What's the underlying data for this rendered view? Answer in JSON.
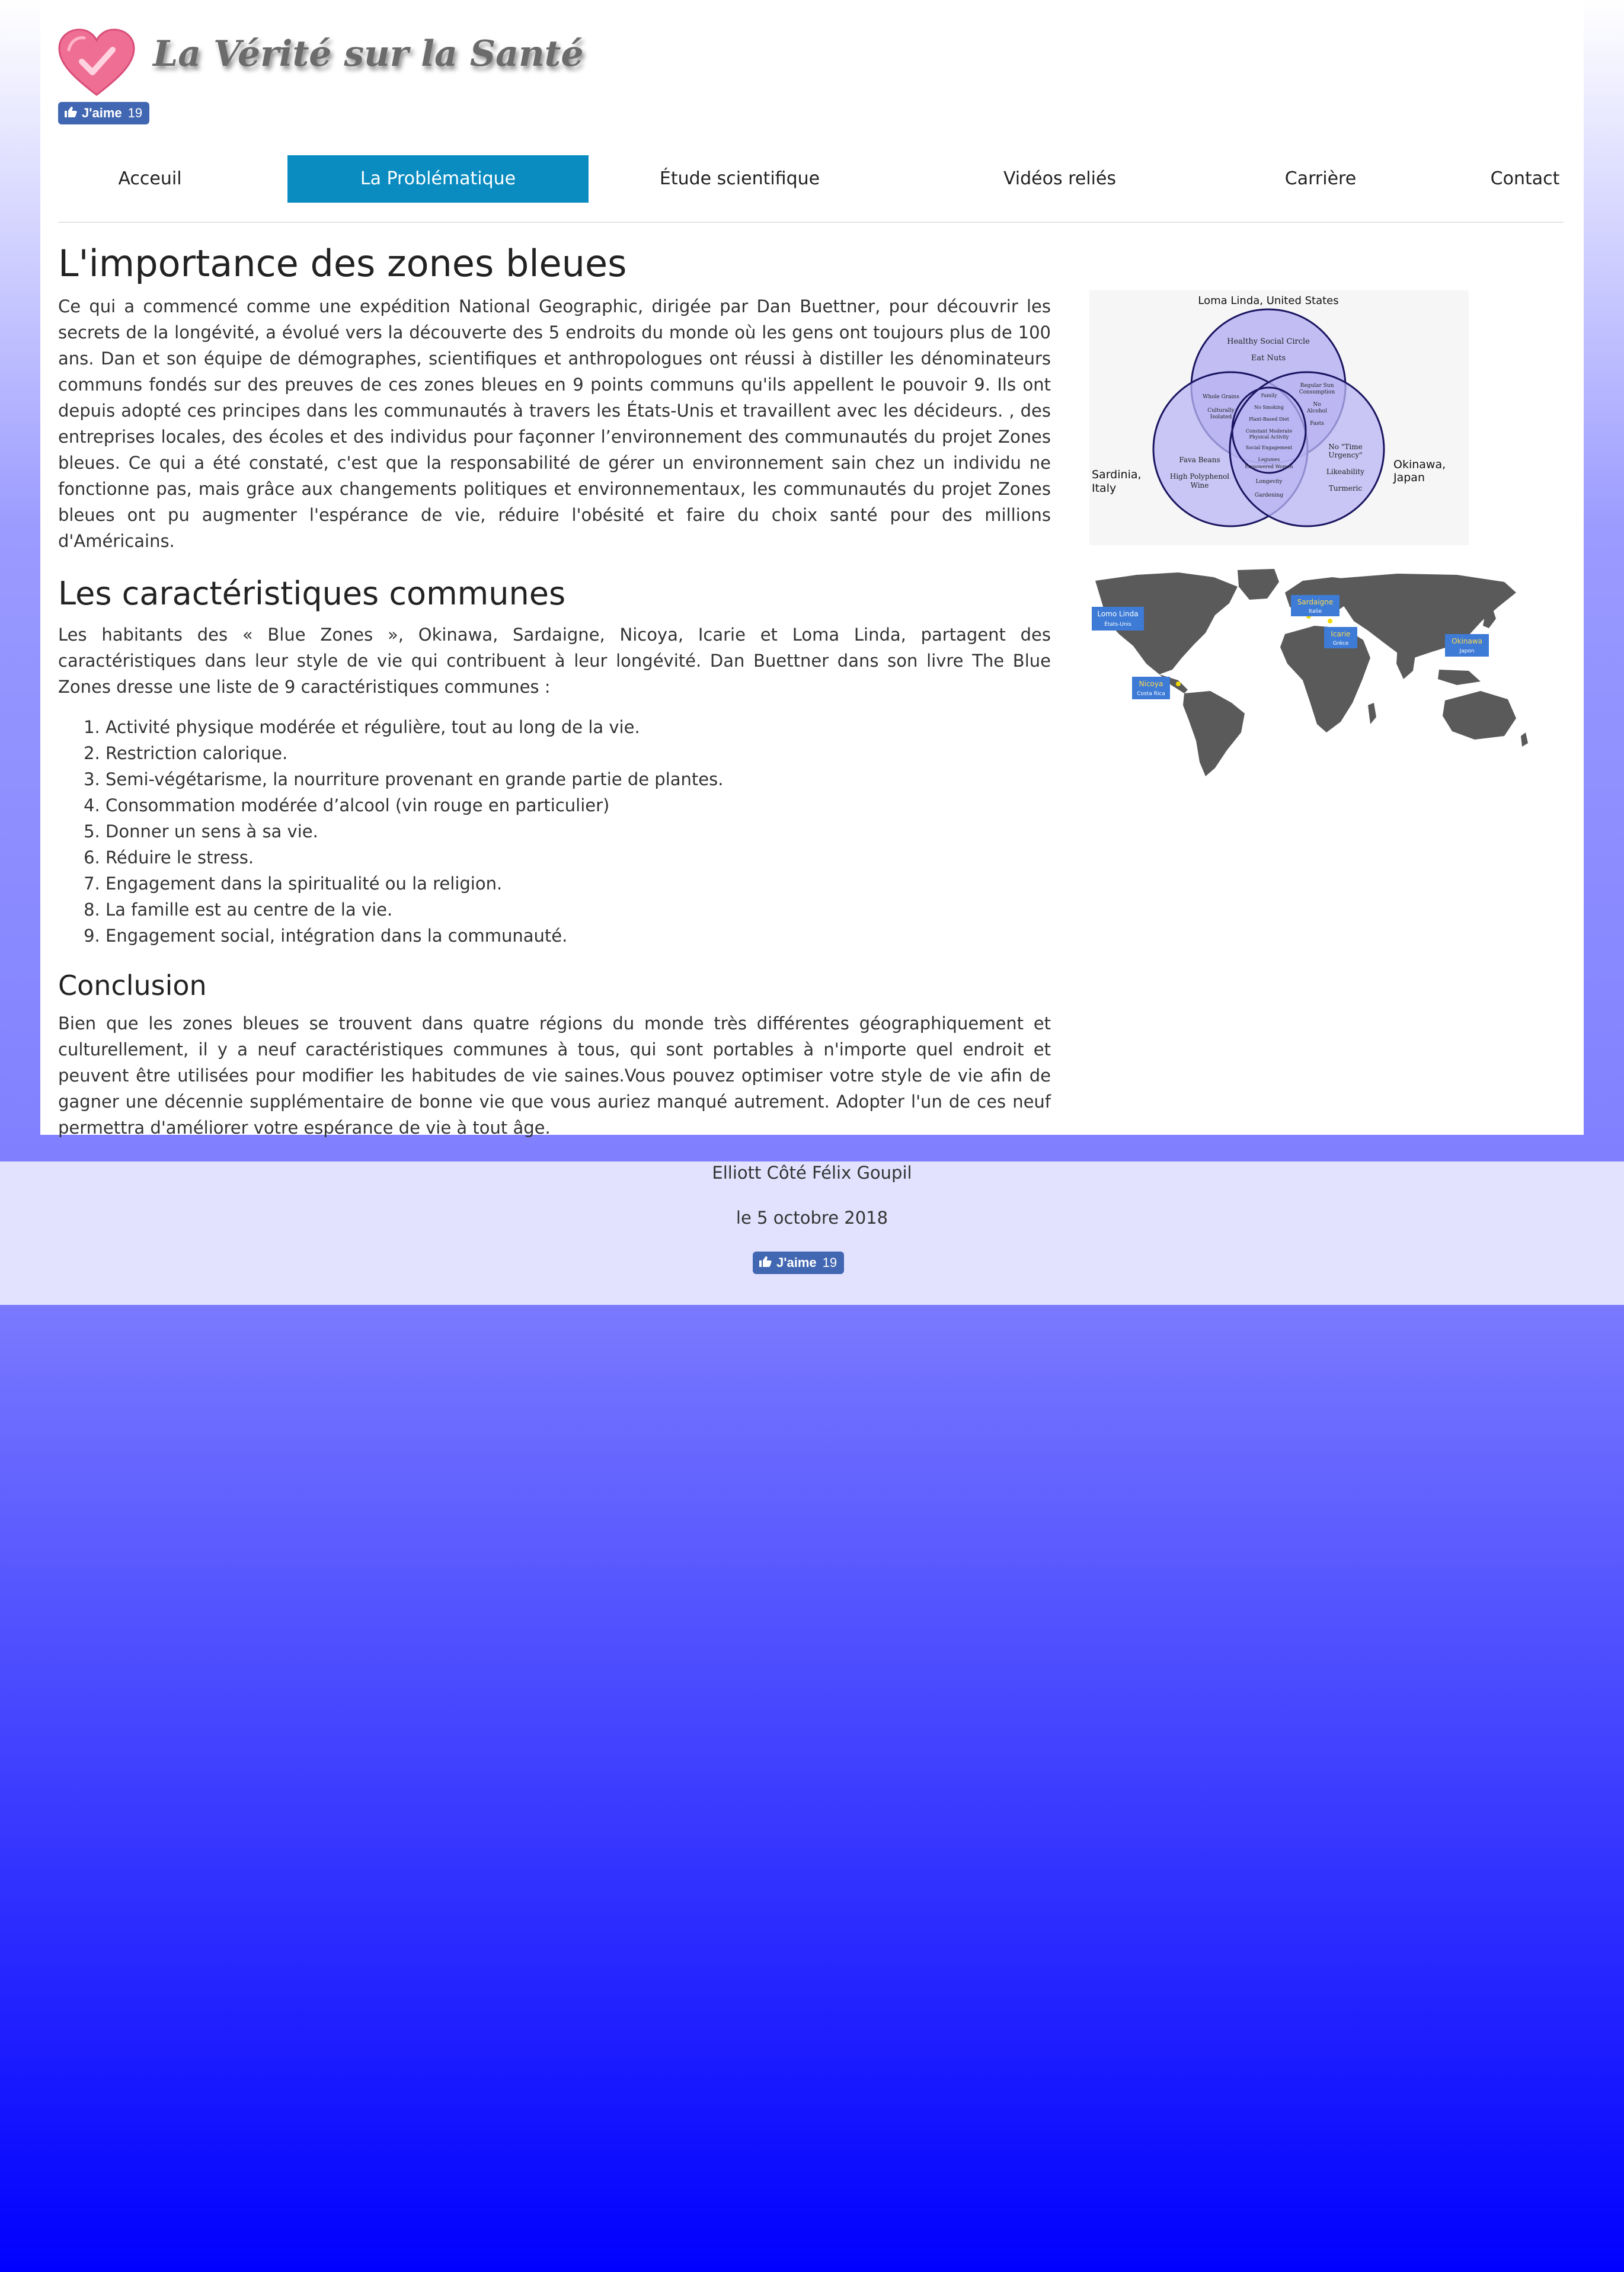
{
  "header": {
    "logo_text": "La Vérité sur la Santé",
    "like_button": {
      "label": "J'aime",
      "count": "19"
    }
  },
  "nav": {
    "items": [
      {
        "label": "Acceuil",
        "active": false
      },
      {
        "label": "La Problématique",
        "active": true
      },
      {
        "label": "Étude scientifique",
        "active": false
      },
      {
        "label": "Vidéos reliés",
        "active": false
      },
      {
        "label": "Carrière",
        "active": false
      },
      {
        "label": "Contact",
        "active": false
      }
    ],
    "active_color": "#0a8cc1"
  },
  "main": {
    "title": "L'importance des zones bleues",
    "intro": "Ce qui a commencé comme une expédition National Geographic, dirigée par Dan Buettner, pour découvrir les secrets de la longévité, a évolué vers la découverte des 5 endroits du monde où les gens ont toujours plus de 100 ans. Dan et son équipe de démographes, scientifiques et anthropologues ont réussi à distiller les dénominateurs communs fondés sur des preuves de ces zones bleues en 9 points communs qu'ils appellent le pouvoir 9. Ils ont depuis adopté ces principes dans les communautés à travers les États-Unis et travaillent avec les décideurs. , des entreprises locales, des écoles et des individus pour façonner l’environnement des communautés du projet Zones bleues. Ce qui a été constaté, c'est que la responsabilité de gérer un environnement sain chez un individu ne fonctionne pas, mais grâce aux changements politiques et environnementaux, les communautés du projet Zones bleues ont pu augmenter l'espérance de vie, réduire l'obésité et faire du choix santé pour des millions d'Américains.",
    "section2_title": "Les caractéristiques communes",
    "section2_text": "Les habitants des « Blue Zones », Okinawa, Sardaigne, Nicoya, Icarie et Loma Linda, partagent des caractéristiques dans leur style de vie qui contribuent à leur longévité. Dan Buettner dans son livre The Blue Zones dresse une liste de 9 caractéristiques communes :",
    "list": [
      "Activité physique modérée et régulière, tout au long de la vie.",
      "Restriction calorique.",
      "Semi-végétarisme, la nourriture provenant en grande partie de plantes.",
      "Consommation modérée d’alcool (vin rouge en particulier)",
      "Donner un sens à sa vie.",
      "Réduire le stress.",
      "Engagement dans la spiritualité ou la religion.",
      "La famille est au centre de la vie.",
      "Engagement social, intégration dans la communauté."
    ],
    "conclusion_title": "Conclusion",
    "conclusion_text": "Bien que les zones bleues se trouvent dans quatre régions du monde très différentes géographiquement et culturellement, il y a neuf caractéristiques communes à tous, qui sont portables à n'importe quel endroit et peuvent être utilisées pour modifier les habitudes de vie saines.Vous pouvez optimiser votre style de vie afin de gagner une décennie supplémentaire de bonne vie que vous auriez manqué autrement. Adopter l'un de ces neuf permettra d'améliorer votre espérance de vie à tout âge."
  },
  "venn": {
    "top_label": "Loma Linda, United States",
    "left_label_1": "Sardinia,",
    "left_label_2": "Italy",
    "right_label_1": "Okinawa,",
    "right_label_2": "Japan",
    "top_only": [
      "Healthy Social Circle",
      "Eat Nuts"
    ],
    "left_only": [
      "Fava Beans",
      "High Polyphenol",
      "Wine"
    ],
    "right_only": [
      "No \"Time",
      "Urgency\"",
      "Likeability",
      "Turmeric"
    ],
    "top_left": [
      "Whole Grains",
      "Culturally",
      "Isolated"
    ],
    "top_right": [
      "Regular Sun",
      "Consumption",
      "No",
      "Alcohol",
      "Fasts"
    ],
    "center": [
      "Family",
      "No Smoking",
      "Plant-Based Diet",
      "Constant Moderate",
      "Physical Activity",
      "Social Engagement"
    ],
    "bottom_center": [
      "Legumes",
      "Empowered Women",
      "Longevity",
      "Gardening"
    ],
    "circle_fill": "#b9b4f3",
    "circle_stroke": "#1a1560"
  },
  "map": {
    "land_color": "#5a5a5a",
    "tag_color": "#3d7bd6",
    "tags": [
      {
        "name": "Lomo Linda",
        "sub": "États-Unis"
      },
      {
        "name": "Sardaigne",
        "sub": "Italie"
      },
      {
        "name": "Icarie",
        "sub": "Grèce"
      },
      {
        "name": "Okinawa",
        "sub": "Japon"
      },
      {
        "name": "Nicoya",
        "sub": "Costa Rica"
      }
    ]
  },
  "footer": {
    "authors": "Elliott Côté Félix Goupil",
    "date": "le 5 octobre 2018",
    "like_button": {
      "label": "J'aime",
      "count": "19"
    }
  }
}
